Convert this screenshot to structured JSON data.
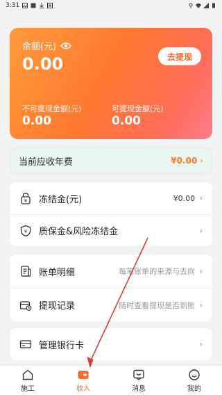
{
  "status_bar": {
    "time": "3:31"
  },
  "balance": {
    "label": "余额(元)",
    "amount": "0.00",
    "withdraw_label": "去提现",
    "non_withdrawable_label": "不可提现金额(元)",
    "non_withdrawable_value": "0.00",
    "withdrawable_label": "可提现金额(元)",
    "withdrawable_value": "0.00"
  },
  "annual_fee": {
    "label": "当前应收年费",
    "value": "¥0.00"
  },
  "freeze_card": {
    "items": [
      {
        "label": "冻结金(元)",
        "value": "¥0.00"
      },
      {
        "label": "质保金&风险冻结金",
        "value": ""
      }
    ]
  },
  "records_card": {
    "items": [
      {
        "label": "账单明细",
        "value": "每笔账单的来源与去向"
      },
      {
        "label": "提现记录",
        "value": "随时查看提现是否到账"
      }
    ]
  },
  "bank_card": {
    "label": "管理银行卡"
  },
  "tabs": [
    {
      "label": "施工",
      "icon": "home-icon"
    },
    {
      "label": "收入",
      "icon": "wallet-icon"
    },
    {
      "label": "消息",
      "icon": "message-icon"
    },
    {
      "label": "我的",
      "icon": "smile-icon"
    }
  ],
  "colors": {
    "accent": "#ff6a2a",
    "card_gradient_start": "#ff9a3c",
    "card_gradient_end": "#ff7b8e",
    "annotation_arrow": "#d6403a"
  }
}
